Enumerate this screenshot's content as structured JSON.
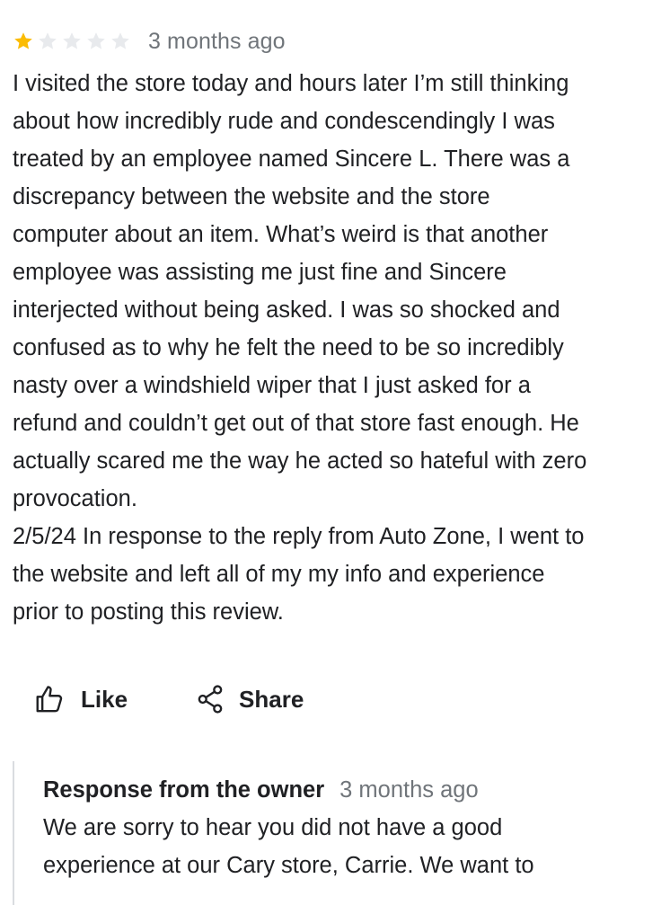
{
  "review": {
    "rating": 1,
    "rating_max": 5,
    "colors": {
      "star_filled": "#fbbc04",
      "star_empty": "#e8eaed",
      "meta_text": "#70757a",
      "body_text": "#202124"
    },
    "time": "3 months ago",
    "text_lines": [
      "I visited the store today and hours later I’m still thinking",
      "about how incredibly rude and condescendingly I was",
      "treated by an employee named Sincere L. There was a",
      "discrepancy between the website and the store",
      "computer about an item. What’s weird is that another",
      "employee was assisting me just fine and Sincere",
      "interjected without being asked. I was so shocked and",
      "confused as to why he felt the need to be so incredibly",
      "nasty over a windshield wiper that I just asked for a",
      "refund and couldn’t get out of that store fast enough. He",
      "actually scared me the way he acted so hateful with zero",
      "provocation.",
      "2/5/24 In response to the reply from Auto Zone, I went to",
      "the website and left all of my my info and experience",
      "prior to posting this review."
    ]
  },
  "actions": {
    "like": {
      "label": "Like",
      "icon": "thumbs-up-icon"
    },
    "share": {
      "label": "Share",
      "icon": "share-icon"
    }
  },
  "owner_response": {
    "title": "Response from the owner",
    "time": "3 months ago",
    "text_lines": [
      "We are sorry to hear you did not have a good",
      "experience at our Cary store, Carrie. We want to"
    ]
  }
}
